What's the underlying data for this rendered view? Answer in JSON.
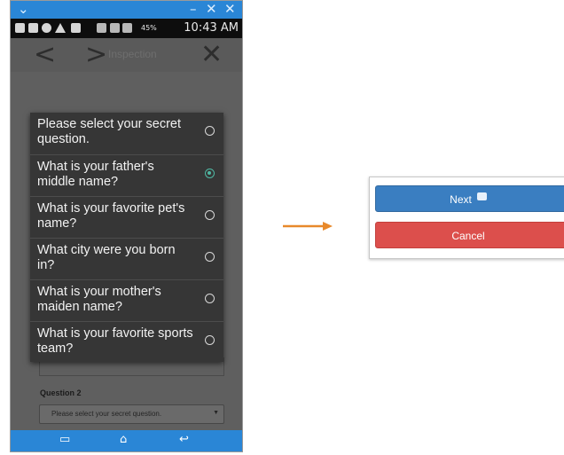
{
  "phone": {
    "status_bar": {
      "battery": "45%",
      "time": "10:43 AM"
    },
    "nav": {
      "title": "Inspection"
    },
    "dialog": {
      "options": [
        {
          "label": "Please select your secret question.",
          "selected": false
        },
        {
          "label": "What is your father's middle name?",
          "selected": true
        },
        {
          "label": "What is your favorite pet's name?",
          "selected": false
        },
        {
          "label": "What city were you born in?",
          "selected": false
        },
        {
          "label": "What is your mother's maiden name?",
          "selected": false
        },
        {
          "label": "What is your favorite sports team?",
          "selected": false
        }
      ]
    },
    "form": {
      "question2_label": "Question 2",
      "question2_value": "Please select your secret question."
    }
  },
  "buttons": {
    "next": "Next",
    "cancel": "Cancel"
  },
  "colors": {
    "accent": "#2a86d6",
    "next": "#3a7ec1",
    "cancel": "#dc4f4c",
    "arrow": "#e8892b",
    "radio_selected": "#4fb8a3"
  }
}
